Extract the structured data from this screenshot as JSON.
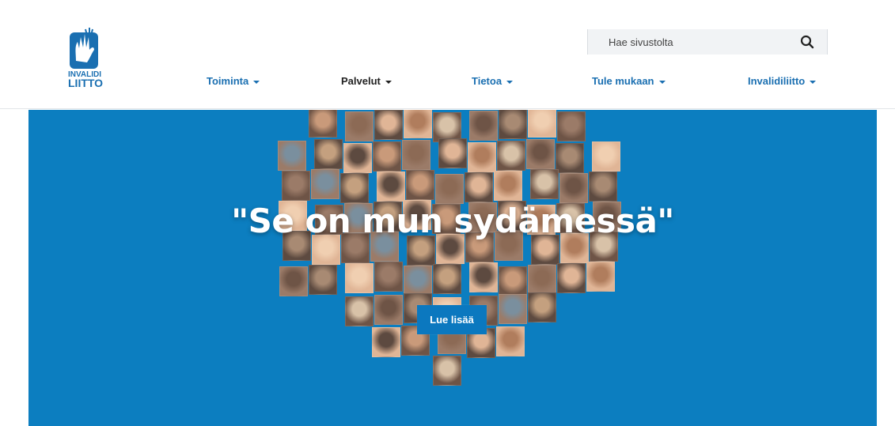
{
  "brand": {
    "name_line1": "INVALIDI",
    "name_line2": "LIITTO",
    "primary_color": "#1a6fb1",
    "hero_color": "#0c7ec0"
  },
  "search": {
    "placeholder": "Hae sivustolta",
    "icon": "search-icon"
  },
  "nav": {
    "items": [
      {
        "label": "Toiminta",
        "active": false
      },
      {
        "label": "Palvelut",
        "active": true
      },
      {
        "label": "Tietoa",
        "active": false
      },
      {
        "label": "Tule mukaan",
        "active": false
      },
      {
        "label": "Invalidiliitto",
        "active": false
      }
    ]
  },
  "hero": {
    "title": "\"Se on mun sydämessä\"",
    "button_label": "Lue lisää"
  }
}
